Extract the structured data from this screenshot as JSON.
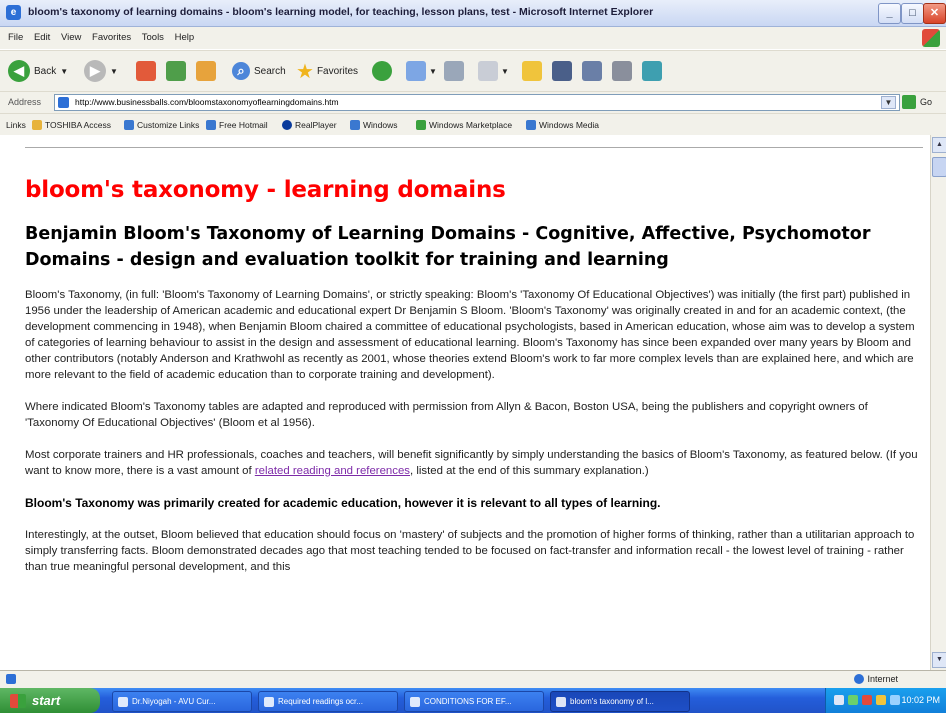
{
  "window": {
    "title": "bloom's taxonomy of learning domains - bloom's learning model, for teaching, lesson plans, test - Microsoft Internet Explorer",
    "minimize": "_",
    "maximize": "□",
    "close": "✕"
  },
  "menu": [
    "File",
    "Edit",
    "View",
    "Favorites",
    "Tools",
    "Help"
  ],
  "toolbar": {
    "back": "Back",
    "search": "Search",
    "favorites": "Favorites"
  },
  "address": {
    "label": "Address",
    "url": "http://www.businessballs.com/bloomstaxonomyoflearningdomains.htm",
    "go": "Go"
  },
  "links": {
    "label": "Links",
    "items": [
      "TOSHIBA Access",
      "Customize Links",
      "Free Hotmail",
      "RealPlayer",
      "Windows",
      "Windows Marketplace",
      "Windows Media"
    ]
  },
  "page": {
    "heading": "bloom's taxonomy - learning domains",
    "subheading": "Benjamin Bloom's Taxonomy of Learning Domains - Cognitive, Affective, Psychomotor Domains - design and evaluation toolkit for training and learning",
    "p1": "Bloom's Taxonomy, (in full: 'Bloom's Taxonomy of Learning Domains', or strictly speaking: Bloom's 'Taxonomy Of Educational Objectives') was initially (the first part) published in 1956 under the leadership of American academic and educational expert Dr Benjamin S Bloom. 'Bloom's Taxonomy' was originally created in and for an academic context, (the development commencing in 1948), when Benjamin Bloom chaired a committee of educational psychologists, based in American education, whose aim was to develop a system of categories of learning behaviour to assist in the design and assessment of educational learning. Bloom's Taxonomy has since been expanded over many years by Bloom and other contributors (notably Anderson and Krathwohl as recently as 2001, whose theories extend Bloom's work to far more complex levels than are explained here, and which are more relevant to the field of academic education than to corporate training and development).",
    "p2": "Where indicated Bloom's Taxonomy tables are adapted and reproduced with permission from Allyn & Bacon, Boston USA, being the publishers and copyright owners of 'Taxonomy Of Educational Objectives' (Bloom et al 1956).",
    "p3_before": "Most corporate trainers and HR professionals, coaches and teachers, will benefit significantly by simply understanding the basics of Bloom's Taxonomy, as featured below. (If you want to know more, there is a vast amount of ",
    "p3_link": "related reading and references",
    "p3_after": ", listed at the end of this summary explanation.)",
    "p4": "Bloom's Taxonomy was primarily created for academic education, however it is relevant to all types of learning.",
    "p5": "Interestingly, at the outset, Bloom believed that education should focus on 'mastery' of subjects and the promotion of higher forms of thinking, rather than a utilitarian approach to simply transferring facts. Bloom demonstrated decades ago that most teaching tended to be focused on fact-transfer and information recall - the lowest level of training - rather than true meaningful personal development, and this"
  },
  "status": {
    "zone": "Internet"
  },
  "taskbar": {
    "start": "start",
    "tasks": [
      "Dr.Niyogah - AVU Cur...",
      "Required readings ocr...",
      "CONDITIONS FOR EF...",
      "bloom's taxonomy of l..."
    ],
    "clock": "10:02 PM"
  },
  "colors": {
    "heading": "#ff0000",
    "link": "#7d2aa8",
    "taskbar": "#245edb",
    "start": "#3aa13d"
  }
}
